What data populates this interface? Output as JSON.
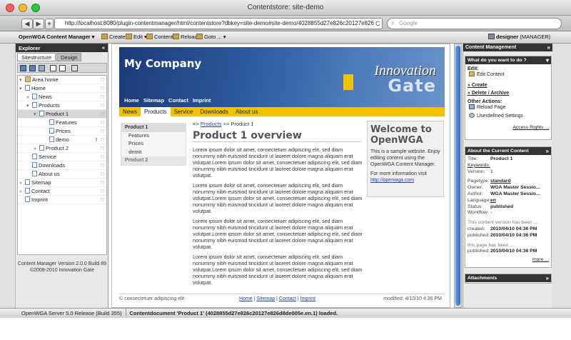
{
  "window": {
    "title": "Contentstore: site-demo"
  },
  "browser": {
    "back": "◀",
    "forward": "▶",
    "add": "+",
    "url": "http://localhost:8080/plugin-contentmanager/html/contentstore?dbkey=site-demo#site-demo/4028855d27e826c20127e826",
    "reload": "C",
    "search_placeholder": "Google"
  },
  "cmtoolbar": {
    "brand": "OpenWGA Content Manager",
    "items": [
      "Create",
      "Edit",
      "Content",
      "Reload",
      "Goto ..."
    ],
    "user": "designer",
    "role": "(MANAGER)"
  },
  "explorer": {
    "title": "Explorer",
    "collapse": "«",
    "tabs": [
      "Sitestructure",
      "Design"
    ],
    "tree": [
      {
        "label": "Area home",
        "toggle": "▾"
      },
      {
        "label": "Home",
        "toggle": "▾"
      },
      {
        "label": "News",
        "toggle": "»"
      },
      {
        "label": "Products",
        "toggle": "▾"
      },
      {
        "label": "Product 1",
        "toggle": "▾"
      },
      {
        "label": "Features",
        "toggle": ""
      },
      {
        "label": "Prices",
        "toggle": ""
      },
      {
        "label": "demo",
        "toggle": ""
      },
      {
        "label": "Product 2",
        "toggle": "»"
      },
      {
        "label": "Service",
        "toggle": ""
      },
      {
        "label": "Downloads",
        "toggle": ""
      },
      {
        "label": "About us",
        "toggle": ""
      },
      {
        "label": "Sitemap",
        "toggle": "»"
      },
      {
        "label": "Contact",
        "toggle": "»"
      },
      {
        "label": "Imprint",
        "toggle": ""
      }
    ],
    "version_line1": "Content Manager Version 2.0.0 Build 89",
    "version_line2": "©2008-2010 Innovation Gate"
  },
  "site": {
    "company": "My Company",
    "logo_line1": "Innovation",
    "logo_line2": "Gate",
    "toplinks": [
      "Home",
      "Sitemap",
      "Contact",
      "Imprint"
    ],
    "nav": [
      "News",
      "Products",
      "Service",
      "Downloads",
      "About us"
    ],
    "subnav": [
      {
        "label": "Product 1",
        "kind": "top"
      },
      {
        "label": "Features",
        "kind": "sub"
      },
      {
        "label": "Prices",
        "kind": "sub"
      },
      {
        "label": "demo",
        "kind": "sub"
      },
      {
        "label": "Product 2",
        "kind": "top"
      }
    ],
    "breadcrumb_prefix": "=>",
    "breadcrumb_link": "Products",
    "breadcrumb_current": "=> Product 1",
    "heading": "Product 1 overview",
    "paragraph": "Lorem ipsum dolor sit amet, consectetuer adipiscing elit, sed diam nonummy nibh euismod tincidunt ut laoreet dolore magna aliquam erat volutpat.Lorem ipsum dolor sit amet, consectetuer adipiscing elit, sed diam nonummy nibh euismod tincidunt ut laoreet dolore magna aliquam erat volutpat.",
    "paragraph_short": "Lorem ipsum dolor sit amet, consectetuer adipiscing elit, sed diam nonummy nibh euismod tincidunt ut laoreet dolore magna aliquam erat volutpat.Lorem ipsum dolor sit amet, consectetuer adipiscing elit, sed diam nonummy nibh euismod tincidunt ut laoreet dolore magna aliquam erat volutpat.",
    "welcome_title": "Welcome to OpenWGA",
    "welcome_text": "This is a sample website. Enjoy editing content using the OpenWGA Content Manager.",
    "welcome_more": "For more information visit",
    "welcome_link": "http://openwga.com",
    "footer_left": "© consectetuer adipiscing elit",
    "footer_links": [
      "Home",
      "Sitemap",
      "Contact",
      "Imprint"
    ],
    "footer_right": "modified: 4/10/10 4:36 PM"
  },
  "rightpanel": {
    "title": "Content Management",
    "expand": "»",
    "q_title": "What do you want to do ?",
    "edit_label": "Edit:",
    "edit_content": "Edit Content",
    "create": "Create",
    "delete_archive": "Delete / Archive",
    "other_actions": "Other Actions:",
    "reload_page": "Reload Page",
    "userdefined": "Userdefined Settings",
    "access_rights": "Access Rights ...",
    "about_title": "About the Current Content",
    "title_key": "Title:",
    "title_val": "Product 1",
    "keywords_key": "Keywords:",
    "version_key": "Version:",
    "version_val": "1",
    "pagetype_key": "Pagetype:",
    "pagetype_val": "standard",
    "owner_key": "Owner:",
    "owner_val": "WGA Master Sessio...",
    "author_key": "Author:",
    "author_val": "WGA Master Sessio...",
    "language_key": "Language:",
    "language_val": "en",
    "status_key": "Status:",
    "status_val": "published",
    "workflow_key": "Workflow:",
    "workflow_val": "-",
    "cv_note": "This content version has been ...",
    "created_key": "created:",
    "created_val": "2010/04/10 04:36 PM",
    "published_key": "published:",
    "published_val": "2010/04/10 04:36 PM",
    "page_note": "this page has been ...",
    "page_published_val": "2010/04/10 04:36 PM",
    "more": "more ...",
    "attachments": "Attachments"
  },
  "statusbar": {
    "left": "OpenWGA Server 5.0 Release (Build 355)",
    "right": "Contentdocument 'Product 1' (4028855d27e826c20127e826d8de005e.en.1) loaded."
  }
}
